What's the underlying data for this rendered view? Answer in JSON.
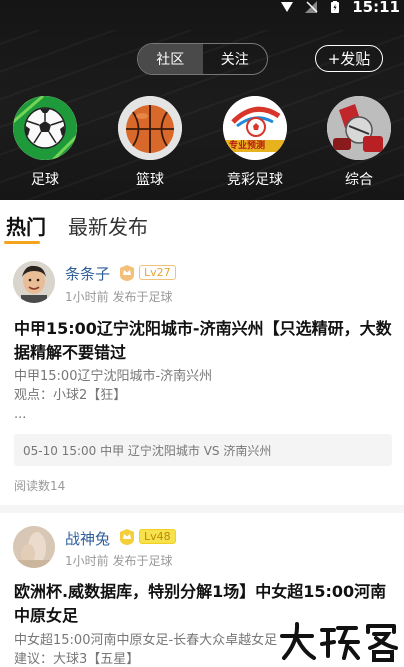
{
  "status_bar": {
    "time": "15:11"
  },
  "header": {
    "segments": [
      {
        "label": "社区",
        "active": true
      },
      {
        "label": "关注",
        "active": false
      }
    ],
    "post_button": "+发贴"
  },
  "categories": [
    {
      "label": "足球",
      "icon": "soccer-ball-icon"
    },
    {
      "label": "篮球",
      "icon": "basketball-icon"
    },
    {
      "label": "竞彩足球",
      "icon": "lottery-football-icon",
      "icon_text": "专业预测"
    },
    {
      "label": "综合",
      "icon": "general-icon"
    }
  ],
  "tabs": [
    {
      "label": "热门",
      "active": true
    },
    {
      "label": "最新发布",
      "active": false
    }
  ],
  "posts": [
    {
      "username": "条条子",
      "level": "Lv27",
      "meta": "1小时前 发布于足球",
      "title": "中甲15:00辽宁沈阳城市-济南兴州【只选精研，大数据精解不要错过",
      "excerpt_lines": [
        "中甲15:00辽宁沈阳城市-济南兴州",
        "观点：小球2【狂】",
        "..."
      ],
      "match": "05-10 15:00 中甲 辽宁沈阳城市 VS 济南兴州",
      "reads": "阅读数14"
    },
    {
      "username": "战神兔",
      "level": "Lv48",
      "meta": "1小时前 发布于足球",
      "title": "欧洲杯.威数据库，特别分解1场】中女超15:00河南中原女足",
      "excerpt_lines": [
        "中女超15:00河南中原女足-长春大众卓越女足",
        "建议：大球3【五星】"
      ]
    }
  ],
  "watermark": "大玩客",
  "colors": {
    "accent": "#f4a41a",
    "username": "#2f5f9a",
    "header_bg": "#1a1a1a"
  }
}
